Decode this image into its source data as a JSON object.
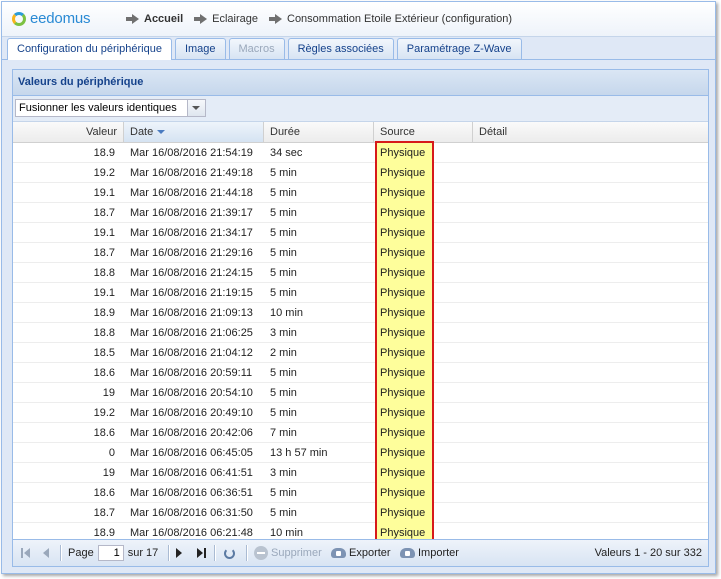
{
  "app": {
    "logo_text": "eedomus"
  },
  "breadcrumb": [
    {
      "label": "Accueil",
      "bold": true
    },
    {
      "label": "Eclairage",
      "bold": false
    },
    {
      "label": "Consommation Etoile Extérieur (configuration)",
      "bold": false
    }
  ],
  "tabs": [
    {
      "label": "Configuration du périphérique",
      "state": "active"
    },
    {
      "label": "Image",
      "state": "normal"
    },
    {
      "label": "Macros",
      "state": "disabled"
    },
    {
      "label": "Règles associées",
      "state": "normal"
    },
    {
      "label": "Paramétrage Z-Wave",
      "state": "normal"
    }
  ],
  "panel": {
    "title": "Valeurs du périphérique",
    "merge_combo": "Fusionner les valeurs identiques"
  },
  "grid": {
    "columns": [
      "Valeur",
      "Date",
      "Durée",
      "Source",
      "Détail"
    ],
    "sorted_column": "Date",
    "rows": [
      [
        "18.9",
        "Mar 16/08/2016 21:54:19",
        "34 sec",
        "Physique",
        ""
      ],
      [
        "19.2",
        "Mar 16/08/2016 21:49:18",
        "5 min",
        "Physique",
        ""
      ],
      [
        "19.1",
        "Mar 16/08/2016 21:44:18",
        "5 min",
        "Physique",
        ""
      ],
      [
        "18.7",
        "Mar 16/08/2016 21:39:17",
        "5 min",
        "Physique",
        ""
      ],
      [
        "19.1",
        "Mar 16/08/2016 21:34:17",
        "5 min",
        "Physique",
        ""
      ],
      [
        "18.7",
        "Mar 16/08/2016 21:29:16",
        "5 min",
        "Physique",
        ""
      ],
      [
        "18.8",
        "Mar 16/08/2016 21:24:15",
        "5 min",
        "Physique",
        ""
      ],
      [
        "19.1",
        "Mar 16/08/2016 21:19:15",
        "5 min",
        "Physique",
        ""
      ],
      [
        "18.9",
        "Mar 16/08/2016 21:09:13",
        "10 min",
        "Physique",
        ""
      ],
      [
        "18.8",
        "Mar 16/08/2016 21:06:25",
        "3 min",
        "Physique",
        ""
      ],
      [
        "18.5",
        "Mar 16/08/2016 21:04:12",
        "2 min",
        "Physique",
        ""
      ],
      [
        "18.6",
        "Mar 16/08/2016 20:59:11",
        "5 min",
        "Physique",
        ""
      ],
      [
        "19",
        "Mar 16/08/2016 20:54:10",
        "5 min",
        "Physique",
        ""
      ],
      [
        "19.2",
        "Mar 16/08/2016 20:49:10",
        "5 min",
        "Physique",
        ""
      ],
      [
        "18.6",
        "Mar 16/08/2016 20:42:06",
        "7 min",
        "Physique",
        ""
      ],
      [
        "0",
        "Mar 16/08/2016 06:45:05",
        "13 h 57 min",
        "Physique",
        ""
      ],
      [
        "19",
        "Mar 16/08/2016 06:41:51",
        "3 min",
        "Physique",
        ""
      ],
      [
        "18.6",
        "Mar 16/08/2016 06:36:51",
        "5 min",
        "Physique",
        ""
      ],
      [
        "18.7",
        "Mar 16/08/2016 06:31:50",
        "5 min",
        "Physique",
        ""
      ],
      [
        "18.9",
        "Mar 16/08/2016 06:21:48",
        "10 min",
        "Physique",
        ""
      ]
    ]
  },
  "pager": {
    "page_label": "Page",
    "current_page": "1",
    "of_label": "sur 17",
    "delete_label": "Supprimer",
    "export_label": "Exporter",
    "import_label": "Importer",
    "info": "Valeurs 1 - 20 sur 332"
  },
  "colors": {
    "source_highlight": "#fefe9b",
    "annotation_border": "#d61a1a",
    "title_text": "#15428b"
  }
}
